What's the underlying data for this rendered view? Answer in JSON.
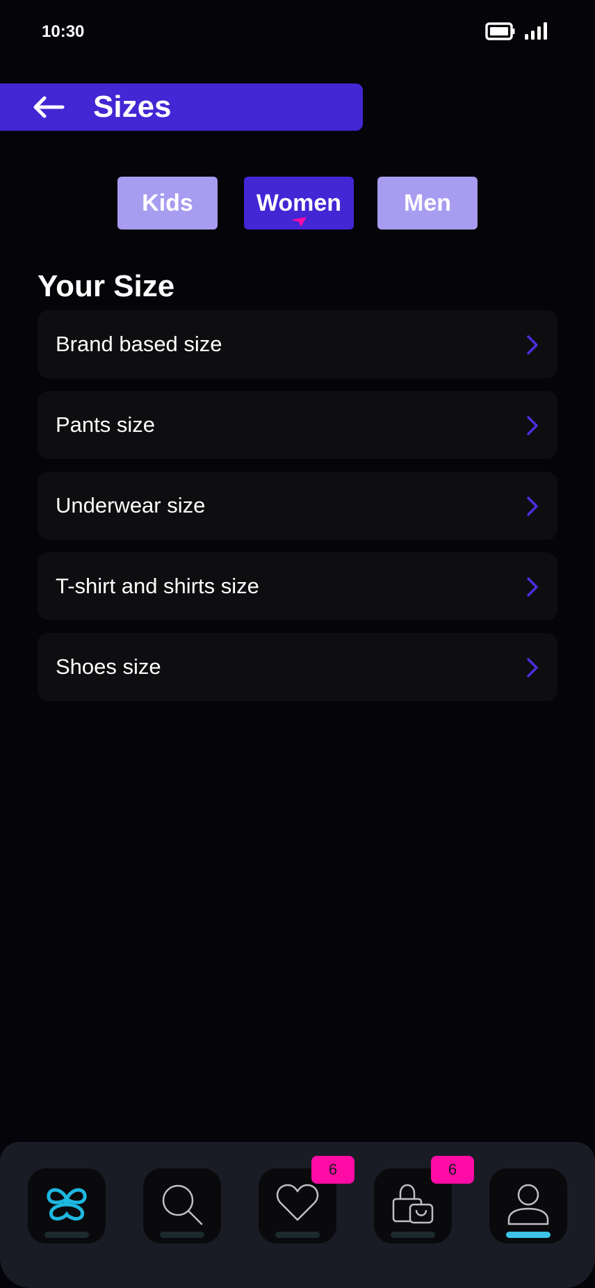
{
  "status_bar": {
    "time": "10:30"
  },
  "header": {
    "title": "Sizes"
  },
  "tabs": [
    {
      "label": "Kids",
      "active": false
    },
    {
      "label": "Women",
      "active": true
    },
    {
      "label": "Men",
      "active": false
    }
  ],
  "section": {
    "title": "Your Size"
  },
  "size_items": [
    {
      "label": "Brand based size"
    },
    {
      "label": "Pants size"
    },
    {
      "label": "Underwear size"
    },
    {
      "label": "T-shirt and shirts size"
    },
    {
      "label": "Shoes size"
    }
  ],
  "bottom_nav": {
    "items": [
      {
        "icon": "brand-logo-icon",
        "active": false
      },
      {
        "icon": "search-icon",
        "active": false
      },
      {
        "icon": "heart-icon",
        "active": false,
        "badge": "6"
      },
      {
        "icon": "shopping-bag-icon",
        "active": false,
        "badge": "6"
      },
      {
        "icon": "profile-icon",
        "active": true
      }
    ]
  },
  "colors": {
    "background": "#050409",
    "accent": "#4326d4",
    "tab_inactive": "#a79cf0",
    "badge": "#ff0ba6",
    "nav_active_indicator": "#3ec2e8",
    "logo": "#1eb8e0"
  }
}
